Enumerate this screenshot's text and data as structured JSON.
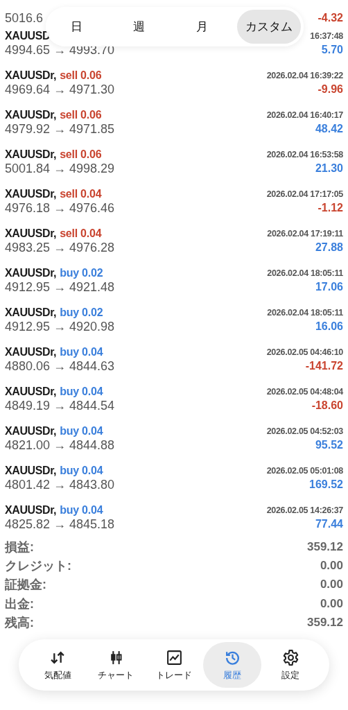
{
  "period_tabs": [
    {
      "label": "日",
      "selected": false
    },
    {
      "label": "週",
      "selected": false
    },
    {
      "label": "月",
      "selected": false
    },
    {
      "label": "カスタム",
      "selected": true
    }
  ],
  "trades": [
    {
      "prices": "5016.6",
      "profit": "-4.32",
      "loss": true
    },
    {
      "symbol": "XAUUSD",
      "time": "16:37:48",
      "prices": "4994.65 → 4993.70",
      "profit": "5.70",
      "loss": false
    },
    {
      "symbol": "XAUUSDr,",
      "side": "sell",
      "volume": "0.06",
      "time": "2026.02.04 16:39:22",
      "prices": "4969.64 → 4971.30",
      "profit": "-9.96",
      "loss": true
    },
    {
      "symbol": "XAUUSDr,",
      "side": "sell",
      "volume": "0.06",
      "time": "2026.02.04 16:40:17",
      "prices": "4979.92 → 4971.85",
      "profit": "48.42",
      "loss": false
    },
    {
      "symbol": "XAUUSDr,",
      "side": "sell",
      "volume": "0.06",
      "time": "2026.02.04 16:53:58",
      "prices": "5001.84 → 4998.29",
      "profit": "21.30",
      "loss": false
    },
    {
      "symbol": "XAUUSDr,",
      "side": "sell",
      "volume": "0.04",
      "time": "2026.02.04 17:17:05",
      "prices": "4976.18 → 4976.46",
      "profit": "-1.12",
      "loss": true
    },
    {
      "symbol": "XAUUSDr,",
      "side": "sell",
      "volume": "0.04",
      "time": "2026.02.04 17:19:11",
      "prices": "4983.25 → 4976.28",
      "profit": "27.88",
      "loss": false
    },
    {
      "symbol": "XAUUSDr,",
      "side": "buy",
      "volume": "0.02",
      "time": "2026.02.04 18:05:11",
      "prices": "4912.95 → 4921.48",
      "profit": "17.06",
      "loss": false
    },
    {
      "symbol": "XAUUSDr,",
      "side": "buy",
      "volume": "0.02",
      "time": "2026.02.04 18:05:11",
      "prices": "4912.95 → 4920.98",
      "profit": "16.06",
      "loss": false
    },
    {
      "symbol": "XAUUSDr,",
      "side": "buy",
      "volume": "0.04",
      "time": "2026.02.05 04:46:10",
      "prices": "4880.06 → 4844.63",
      "profit": "-141.72",
      "loss": true
    },
    {
      "symbol": "XAUUSDr,",
      "side": "buy",
      "volume": "0.04",
      "time": "2026.02.05 04:48:04",
      "prices": "4849.19 → 4844.54",
      "profit": "-18.60",
      "loss": true
    },
    {
      "symbol": "XAUUSDr,",
      "side": "buy",
      "volume": "0.04",
      "time": "2026.02.05 04:52:03",
      "prices": "4821.00 → 4844.88",
      "profit": "95.52",
      "loss": false
    },
    {
      "symbol": "XAUUSDr,",
      "side": "buy",
      "volume": "0.04",
      "time": "2026.02.05 05:01:08",
      "prices": "4801.42 → 4843.80",
      "profit": "169.52",
      "loss": false
    },
    {
      "symbol": "XAUUSDr,",
      "side": "buy",
      "volume": "0.04",
      "time": "2026.02.05 14:26:37",
      "prices": "4825.82 → 4845.18",
      "profit": "77.44",
      "loss": false
    }
  ],
  "summary": [
    {
      "label": "損益:",
      "value": "359.12"
    },
    {
      "label": "クレジット:",
      "value": "0.00"
    },
    {
      "label": "証拠金:",
      "value": "0.00"
    },
    {
      "label": "出金:",
      "value": "0.00"
    },
    {
      "label": "残高:",
      "value": "359.12"
    }
  ],
  "nav": [
    {
      "kind": "quotes",
      "label": "気配値",
      "selected": false
    },
    {
      "kind": "chart",
      "label": "チャート",
      "selected": false
    },
    {
      "kind": "trade",
      "label": "トレード",
      "selected": false
    },
    {
      "kind": "history",
      "label": "履歴",
      "selected": true
    },
    {
      "kind": "settings",
      "label": "設定",
      "selected": false
    }
  ]
}
